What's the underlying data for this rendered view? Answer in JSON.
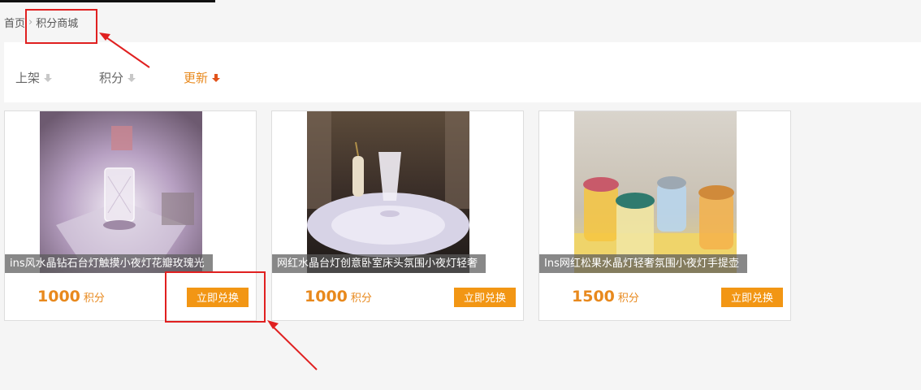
{
  "breadcrumb": {
    "home": "首页",
    "current": "积分商城"
  },
  "sort": {
    "items": [
      {
        "label": "上架",
        "active": false
      },
      {
        "label": "积分",
        "active": false
      },
      {
        "label": "更新",
        "active": true
      }
    ]
  },
  "products": [
    {
      "title": "ins风水晶钻石台灯触摸小夜灯花瓣玫瑰光",
      "points": "1000",
      "unit": "积分",
      "button": "立即兑换"
    },
    {
      "title": "网红水晶台灯创意卧室床头氛围小夜灯轻奢",
      "points": "1000",
      "unit": "积分",
      "button": "立即兑换"
    },
    {
      "title": "Ins网红松果水晶灯轻奢氛围小夜灯手提壶",
      "points": "1500",
      "unit": "积分",
      "button": "立即兑换"
    }
  ],
  "colors": {
    "accent": "#e8891d",
    "button": "#f29614",
    "annotation": "#e02020"
  }
}
